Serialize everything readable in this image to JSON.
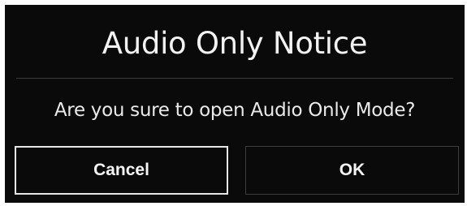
{
  "dialog": {
    "title": "Audio Only Notice",
    "message": "Are you sure to open Audio Only Mode?",
    "cancel_label": "Cancel",
    "ok_label": "OK"
  },
  "colors": {
    "dialog_background": "#0a0a0a",
    "text": "#f2f2f2",
    "focused_button_border": "#e6e6e6",
    "button_border": "#3c3c3c"
  }
}
